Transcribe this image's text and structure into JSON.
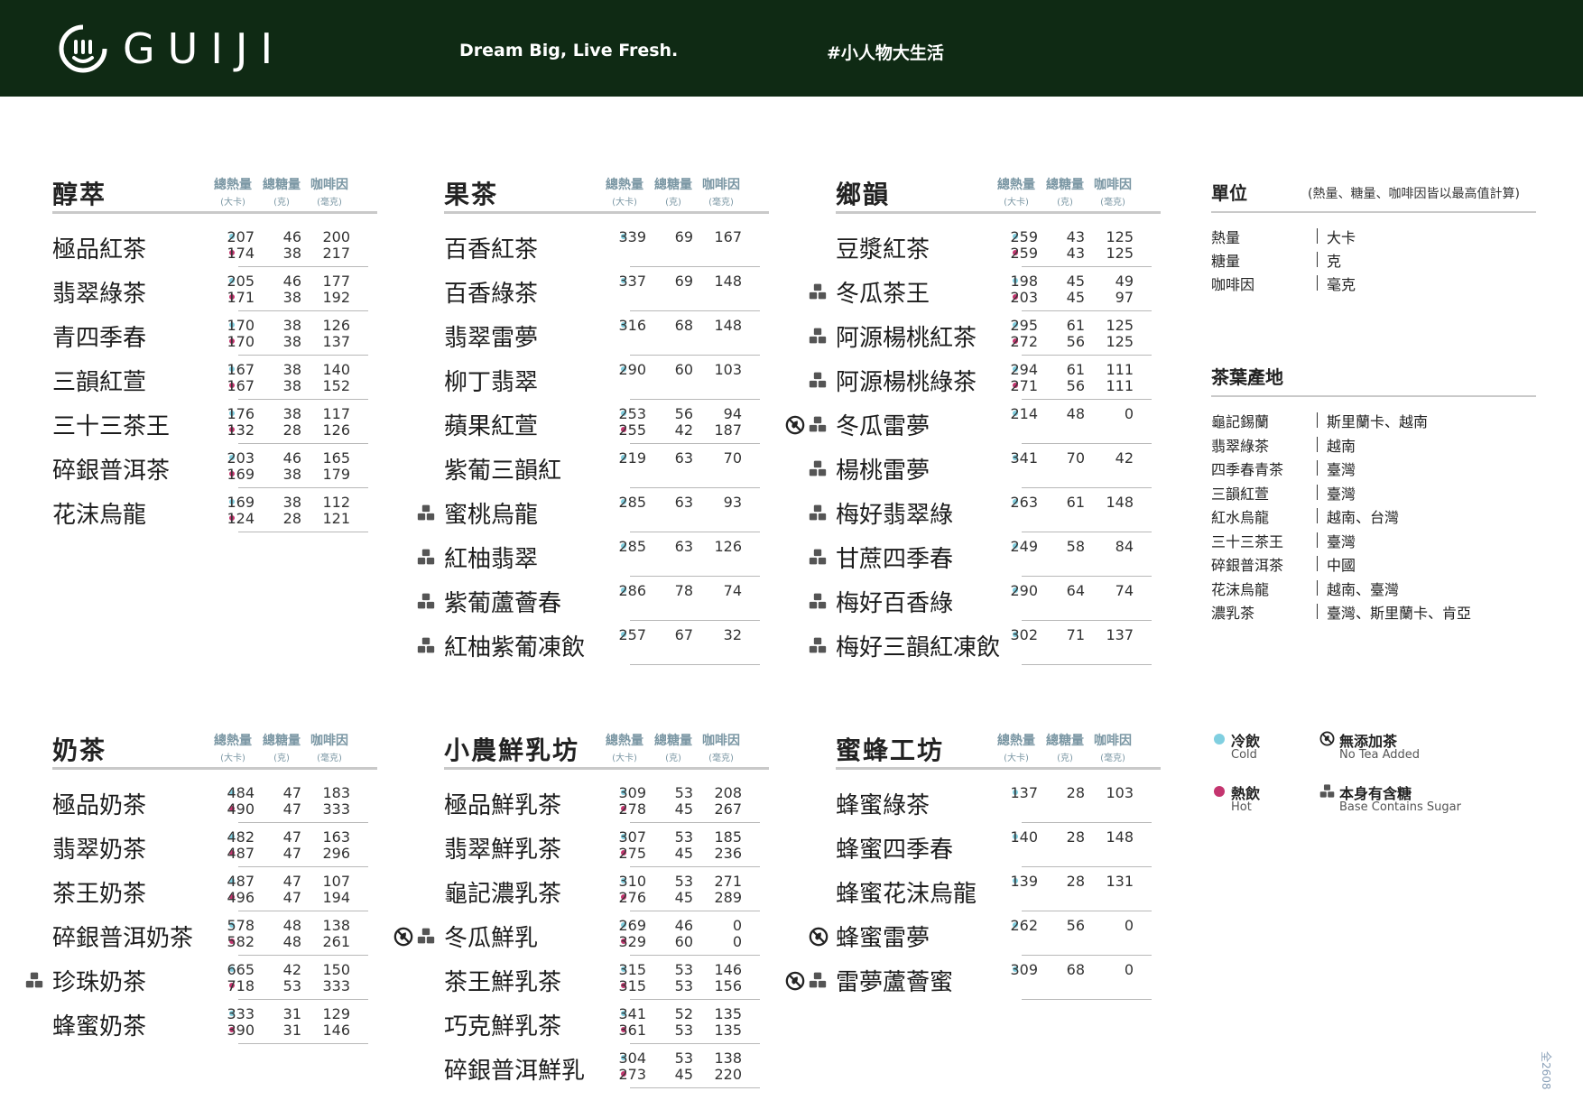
{
  "header": {
    "brand": "GUIJI",
    "slogan": "Dream Big, Live Fresh.",
    "hashtag": "#小人物大生活"
  },
  "columns": {
    "cal": "總熱量",
    "cal_unit": "(大卡)",
    "sugar": "總糖量",
    "sugar_unit": "(克)",
    "caf": "咖啡因",
    "caf_unit": "(毫克)"
  },
  "sections": [
    {
      "title": "醇萃",
      "items": [
        {
          "name": "極品紅茶",
          "sugar_base": false,
          "no_tea": false,
          "cold": [
            "207",
            "46",
            "200"
          ],
          "hot": [
            "174",
            "38",
            "217"
          ]
        },
        {
          "name": "翡翠綠茶",
          "sugar_base": false,
          "no_tea": false,
          "cold": [
            "205",
            "46",
            "177"
          ],
          "hot": [
            "171",
            "38",
            "192"
          ]
        },
        {
          "name": "青四季春",
          "sugar_base": false,
          "no_tea": false,
          "cold": [
            "170",
            "38",
            "126"
          ],
          "hot": [
            "170",
            "38",
            "137"
          ]
        },
        {
          "name": "三韻紅萱",
          "sugar_base": false,
          "no_tea": false,
          "cold": [
            "167",
            "38",
            "140"
          ],
          "hot": [
            "167",
            "38",
            "152"
          ]
        },
        {
          "name": "三十三茶王",
          "sugar_base": false,
          "no_tea": false,
          "cold": [
            "176",
            "38",
            "117"
          ],
          "hot": [
            "132",
            "28",
            "126"
          ]
        },
        {
          "name": "碎銀普洱茶",
          "sugar_base": false,
          "no_tea": false,
          "cold": [
            "203",
            "46",
            "165"
          ],
          "hot": [
            "169",
            "38",
            "179"
          ]
        },
        {
          "name": "花沫烏龍",
          "sugar_base": false,
          "no_tea": false,
          "cold": [
            "169",
            "38",
            "112"
          ],
          "hot": [
            "124",
            "28",
            "121"
          ]
        }
      ]
    },
    {
      "title": "果茶",
      "items": [
        {
          "name": "百香紅茶",
          "sugar_base": false,
          "no_tea": false,
          "cold": [
            "339",
            "69",
            "167"
          ]
        },
        {
          "name": "百香綠茶",
          "sugar_base": false,
          "no_tea": false,
          "cold": [
            "337",
            "69",
            "148"
          ]
        },
        {
          "name": "翡翠雷夢",
          "sugar_base": false,
          "no_tea": false,
          "cold": [
            "316",
            "68",
            "148"
          ]
        },
        {
          "name": "柳丁翡翠",
          "sugar_base": false,
          "no_tea": false,
          "cold": [
            "290",
            "60",
            "103"
          ]
        },
        {
          "name": "蘋果紅萱",
          "sugar_base": false,
          "no_tea": false,
          "cold": [
            "253",
            "56",
            "94"
          ],
          "hot": [
            "255",
            "42",
            "187"
          ]
        },
        {
          "name": "紫葡三韻紅",
          "sugar_base": false,
          "no_tea": false,
          "cold": [
            "219",
            "63",
            "70"
          ]
        },
        {
          "name": "蜜桃烏龍",
          "sugar_base": true,
          "no_tea": false,
          "cold": [
            "285",
            "63",
            "93"
          ]
        },
        {
          "name": "紅柚翡翠",
          "sugar_base": true,
          "no_tea": false,
          "cold": [
            "285",
            "63",
            "126"
          ]
        },
        {
          "name": "紫葡蘆薈春",
          "sugar_base": true,
          "no_tea": false,
          "cold": [
            "286",
            "78",
            "74"
          ]
        },
        {
          "name": "紅柚紫葡凍飲",
          "sugar_base": true,
          "no_tea": false,
          "cold": [
            "257",
            "67",
            "32"
          ]
        }
      ]
    },
    {
      "title": "鄉韻",
      "items": [
        {
          "name": "豆漿紅茶",
          "sugar_base": false,
          "no_tea": false,
          "cold": [
            "259",
            "43",
            "125"
          ],
          "hot": [
            "259",
            "43",
            "125"
          ]
        },
        {
          "name": "冬瓜茶王",
          "sugar_base": true,
          "no_tea": false,
          "cold": [
            "198",
            "45",
            "49"
          ],
          "hot": [
            "203",
            "45",
            "97"
          ]
        },
        {
          "name": "阿源楊桃紅茶",
          "sugar_base": true,
          "no_tea": false,
          "cold": [
            "295",
            "61",
            "125"
          ],
          "hot": [
            "272",
            "56",
            "125"
          ]
        },
        {
          "name": "阿源楊桃綠茶",
          "sugar_base": true,
          "no_tea": false,
          "cold": [
            "294",
            "61",
            "111"
          ],
          "hot": [
            "271",
            "56",
            "111"
          ]
        },
        {
          "name": "冬瓜雷夢",
          "sugar_base": true,
          "no_tea": true,
          "cold": [
            "214",
            "48",
            "0"
          ]
        },
        {
          "name": "楊桃雷夢",
          "sugar_base": true,
          "no_tea": false,
          "cold": [
            "341",
            "70",
            "42"
          ]
        },
        {
          "name": "梅好翡翠綠",
          "sugar_base": true,
          "no_tea": false,
          "cold": [
            "263",
            "61",
            "148"
          ]
        },
        {
          "name": "甘蔗四季春",
          "sugar_base": true,
          "no_tea": false,
          "cold": [
            "249",
            "58",
            "84"
          ]
        },
        {
          "name": "梅好百香綠",
          "sugar_base": true,
          "no_tea": false,
          "cold": [
            "290",
            "64",
            "74"
          ]
        },
        {
          "name": "梅好三韻紅凍飲",
          "sugar_base": true,
          "no_tea": false,
          "cold": [
            "302",
            "71",
            "137"
          ]
        }
      ]
    },
    {
      "title": "奶茶",
      "items": [
        {
          "name": "極品奶茶",
          "sugar_base": false,
          "no_tea": false,
          "cold": [
            "484",
            "47",
            "183"
          ],
          "hot": [
            "490",
            "47",
            "333"
          ]
        },
        {
          "name": "翡翠奶茶",
          "sugar_base": false,
          "no_tea": false,
          "cold": [
            "482",
            "47",
            "163"
          ],
          "hot": [
            "487",
            "47",
            "296"
          ]
        },
        {
          "name": "茶王奶茶",
          "sugar_base": false,
          "no_tea": false,
          "cold": [
            "487",
            "47",
            "107"
          ],
          "hot": [
            "496",
            "47",
            "194"
          ]
        },
        {
          "name": "碎銀普洱奶茶",
          "sugar_base": false,
          "no_tea": false,
          "cold": [
            "578",
            "48",
            "138"
          ],
          "hot": [
            "582",
            "48",
            "261"
          ]
        },
        {
          "name": "珍珠奶茶",
          "sugar_base": true,
          "no_tea": false,
          "cold": [
            "665",
            "42",
            "150"
          ],
          "hot": [
            "718",
            "53",
            "333"
          ]
        },
        {
          "name": "蜂蜜奶茶",
          "sugar_base": false,
          "no_tea": false,
          "cold": [
            "333",
            "31",
            "129"
          ],
          "hot": [
            "390",
            "31",
            "146"
          ]
        }
      ]
    },
    {
      "title": "小農鮮乳坊",
      "items": [
        {
          "name": "極品鮮乳茶",
          "sugar_base": false,
          "no_tea": false,
          "cold": [
            "309",
            "53",
            "208"
          ],
          "hot": [
            "278",
            "45",
            "267"
          ]
        },
        {
          "name": "翡翠鮮乳茶",
          "sugar_base": false,
          "no_tea": false,
          "cold": [
            "307",
            "53",
            "185"
          ],
          "hot": [
            "275",
            "45",
            "236"
          ]
        },
        {
          "name": "龜記濃乳茶",
          "sugar_base": false,
          "no_tea": false,
          "cold": [
            "310",
            "53",
            "271"
          ],
          "hot": [
            "276",
            "45",
            "289"
          ]
        },
        {
          "name": "冬瓜鮮乳",
          "sugar_base": true,
          "no_tea": true,
          "cold": [
            "269",
            "46",
            "0"
          ],
          "hot": [
            "329",
            "60",
            "0"
          ]
        },
        {
          "name": "茶王鮮乳茶",
          "sugar_base": false,
          "no_tea": false,
          "cold": [
            "315",
            "53",
            "146"
          ],
          "hot": [
            "315",
            "53",
            "156"
          ]
        },
        {
          "name": "巧克鮮乳茶",
          "sugar_base": false,
          "no_tea": false,
          "cold": [
            "341",
            "52",
            "135"
          ],
          "hot": [
            "361",
            "53",
            "135"
          ]
        },
        {
          "name": "碎銀普洱鮮乳",
          "sugar_base": false,
          "no_tea": false,
          "cold": [
            "304",
            "53",
            "138"
          ],
          "hot": [
            "273",
            "45",
            "220"
          ]
        }
      ]
    },
    {
      "title": "蜜蜂工坊",
      "items": [
        {
          "name": "蜂蜜綠茶",
          "sugar_base": false,
          "no_tea": false,
          "cold": [
            "137",
            "28",
            "103"
          ]
        },
        {
          "name": "蜂蜜四季春",
          "sugar_base": false,
          "no_tea": false,
          "cold": [
            "140",
            "28",
            "148"
          ]
        },
        {
          "name": "蜂蜜花沫烏龍",
          "sugar_base": false,
          "no_tea": false,
          "cold": [
            "139",
            "28",
            "131"
          ]
        },
        {
          "name": "蜂蜜雷夢",
          "sugar_base": false,
          "no_tea": true,
          "cold": [
            "262",
            "56",
            "0"
          ]
        },
        {
          "name": "雷夢蘆薈蜜",
          "sugar_base": true,
          "no_tea": true,
          "cold": [
            "309",
            "68",
            "0"
          ]
        }
      ]
    }
  ],
  "units": {
    "title": "單位",
    "note": "(熱量、糖量、咖啡因皆以最高值計算)",
    "rows": [
      {
        "k": "熱量",
        "v": "大卡"
      },
      {
        "k": "糖量",
        "v": "克"
      },
      {
        "k": "咖啡因",
        "v": "毫克"
      }
    ]
  },
  "origins": {
    "title": "茶葉產地",
    "rows": [
      {
        "k": "龜記錫蘭",
        "v": "斯里蘭卡、越南"
      },
      {
        "k": "翡翠綠茶",
        "v": "越南"
      },
      {
        "k": "四季春青茶",
        "v": "臺灣"
      },
      {
        "k": "三韻紅萱",
        "v": "臺灣"
      },
      {
        "k": "紅水烏龍",
        "v": "越南、台灣"
      },
      {
        "k": "三十三茶王",
        "v": "臺灣"
      },
      {
        "k": "碎銀普洱茶",
        "v": "中國"
      },
      {
        "k": "花沫烏龍",
        "v": "越南、臺灣"
      },
      {
        "k": "濃乳茶",
        "v": "臺灣、斯里蘭卡、肯亞"
      }
    ]
  },
  "legend": {
    "cold": "冷飲",
    "cold_en": "Cold",
    "hot": "熱飲",
    "hot_en": "Hot",
    "no_tea": "無添加茶",
    "no_tea_en": "No Tea Added",
    "sugar": "本身有含糖",
    "sugar_en": "Base Contains Sugar"
  },
  "colors": {
    "cold": "#80cfe0",
    "hot": "#c4356f",
    "header_bg": "#0f2a14"
  },
  "icons": {
    "sugar": "sugar-cubes-icon",
    "no_tea": "no-tea-icon",
    "logo": "guiji-logo-icon"
  },
  "code": "全2608"
}
